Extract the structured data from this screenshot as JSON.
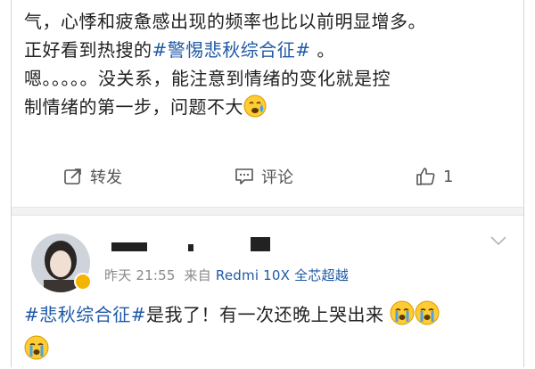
{
  "post": {
    "line1": "气，心悸和疲惫感出现的频率也比以前明显增多。",
    "line2_prefix": "正好看到热搜的",
    "line2_tag": "#警惕悲秋综合征#",
    "line2_suffix": " 。",
    "line3": "嗯。。。。。没关系，能注意到情绪的变化就是控",
    "line4": "制情绪的第一步，问题不大"
  },
  "actions": {
    "repost_label": "转发",
    "comment_label": "评论",
    "like_count": "1"
  },
  "comment": {
    "time": "昨天 21:55",
    "source_prefix": "来自",
    "device": "Redmi 10X 全芯超越",
    "tag": "#悲秋综合征#",
    "text": "是我了！有一次还晚上哭出来"
  },
  "colors": {
    "link": "#1f5aa6",
    "meta": "#8a8a8a",
    "divider_band": "#f2f2f2"
  },
  "icons": [
    "sob-emoji-icon",
    "repost-icon",
    "comment-icon",
    "like-icon",
    "chevron-down-icon",
    "verified-badge-icon",
    "crying-emoji-icon"
  ]
}
